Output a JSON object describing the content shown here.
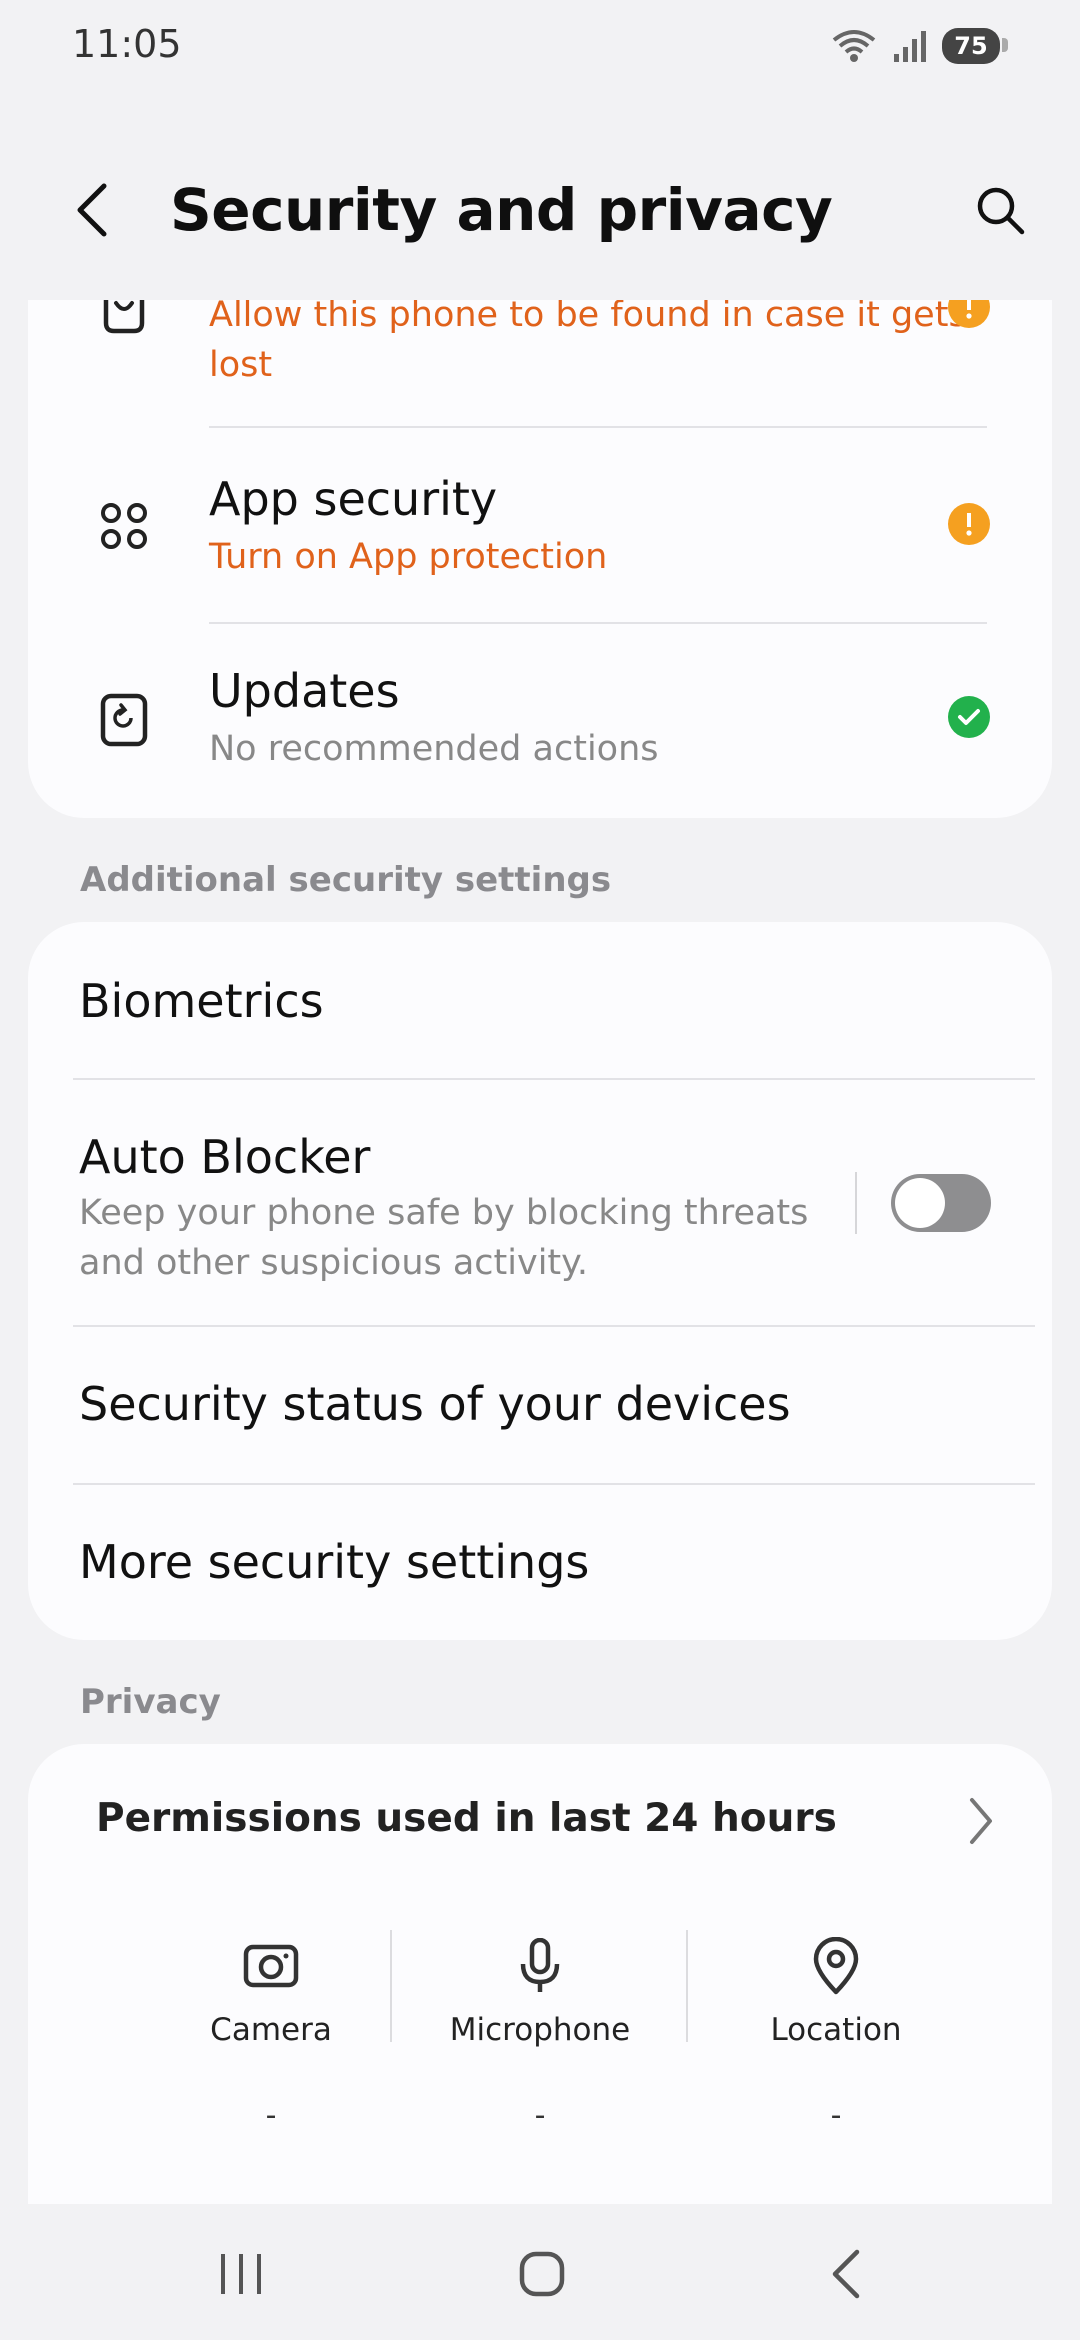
{
  "status_bar": {
    "time": "11:05",
    "battery": "75"
  },
  "header": {
    "title": "Security and privacy"
  },
  "security_items": [
    {
      "title": "",
      "subtitle": "Allow this phone to be found in case it gets lost",
      "status": "warning",
      "icon": "find-phone-icon"
    },
    {
      "title": "App security",
      "subtitle": "Turn on App protection",
      "status": "warning",
      "icon": "apps-grid-icon"
    },
    {
      "title": "Updates",
      "subtitle": "No recommended actions",
      "status": "ok",
      "icon": "update-icon"
    }
  ],
  "additional": {
    "label": "Additional security settings",
    "biometrics": "Biometrics",
    "auto_blocker": {
      "title": "Auto Blocker",
      "subtitle": "Keep your phone safe by blocking threats and other suspicious activity.",
      "enabled": false
    },
    "security_status": "Security status of your devices",
    "more_settings": "More security settings"
  },
  "privacy": {
    "label": "Privacy",
    "permissions_title": "Permissions used in last 24 hours",
    "permissions": [
      {
        "label": "Camera",
        "value": "-",
        "icon": "camera-icon"
      },
      {
        "label": "Microphone",
        "value": "-",
        "icon": "microphone-icon"
      },
      {
        "label": "Location",
        "value": "-",
        "icon": "location-icon"
      }
    ]
  },
  "colors": {
    "warning": "#f5a020",
    "ok": "#22b14c",
    "warning_text": "#e0621b"
  }
}
